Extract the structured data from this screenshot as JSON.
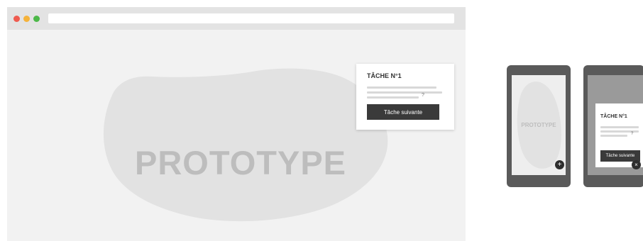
{
  "colors": {
    "red": "#ef5b4f",
    "yellow": "#f5b23a",
    "green": "#4cb848",
    "blob": "#e2e2e2",
    "dark_button": "#3a3a3a"
  },
  "browser": {
    "window_controls": [
      "close-dot",
      "minimize-dot",
      "maximize-dot"
    ],
    "canvas_text": "PROTOTYPE",
    "task_card": {
      "title": "TÂCHE N°1",
      "question_mark": "?",
      "button_label": "Tâche suivante"
    }
  },
  "phones": [
    {
      "canvas_text": "PROTOTYPE",
      "fab_icon": "plus-icon",
      "fab_glyph": "+"
    },
    {
      "fab_icon": "close-icon",
      "fab_glyph": "×",
      "task_card": {
        "title": "TÂCHE N°1",
        "question_mark": "?",
        "button_label": "Tâche suivante"
      }
    }
  ]
}
